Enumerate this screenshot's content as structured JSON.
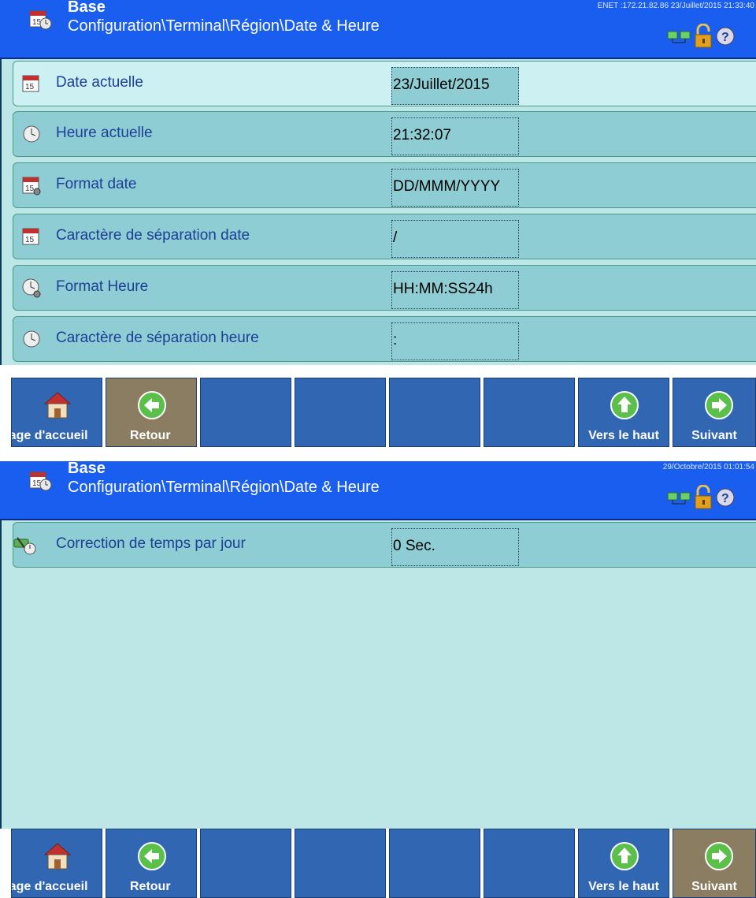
{
  "screens": [
    {
      "header": {
        "title": "Base",
        "path": "Configuration\\Terminal\\Région\\Date & Heure",
        "status": "ENET :172.21.82.86  23/Juillet/2015 21:33:40"
      },
      "rows": [
        {
          "label": "Date actuelle",
          "value": "23/Juillet/2015",
          "icon": "calendar-icon"
        },
        {
          "label": "Heure actuelle",
          "value": "21:32:07",
          "icon": "clock-icon"
        },
        {
          "label": "Format date",
          "value": "DD/MMM/YYYY",
          "icon": "calendar-settings-icon"
        },
        {
          "label": "Caractère de séparation date",
          "value": "/",
          "icon": "calendar-icon"
        },
        {
          "label": "Format Heure",
          "value": "HH:MM:SS24h",
          "icon": "clock-settings-icon"
        },
        {
          "label": "Caractère de séparation heure",
          "value": ":",
          "icon": "clock-icon"
        }
      ],
      "toolbar": {
        "home": "Page d'accueil",
        "back": "Retour",
        "up": "Vers le haut",
        "next": "Suivant"
      }
    },
    {
      "header": {
        "title": "Base",
        "path": "Configuration\\Terminal\\Région\\Date & Heure",
        "status": "29/Octobre/2015 01:01:54"
      },
      "rows": [
        {
          "label": "Correction de temps par jour",
          "value": "0 Sec.",
          "icon": "time-correction-icon"
        }
      ],
      "toolbar": {
        "home": "Page d'accueil",
        "back": "Retour",
        "up": "Vers le haut",
        "next": "Suivant"
      }
    }
  ],
  "colors": {
    "header": "#1a5ef0",
    "content": "#bde7e6",
    "row": "#8dcdd3",
    "button": "#3166b3",
    "button_active": "#8a7d62",
    "label_text": "#1d3f95"
  }
}
